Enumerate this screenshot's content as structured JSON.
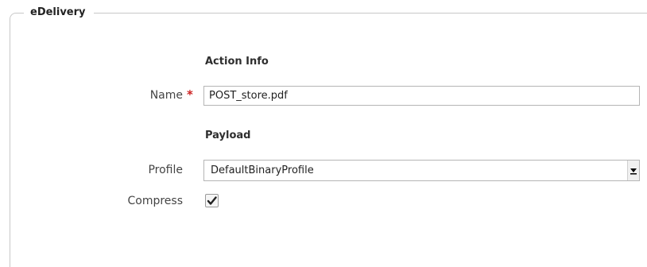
{
  "fieldset": {
    "legend": "eDelivery"
  },
  "action_info": {
    "title": "Action Info",
    "name_label": "Name",
    "required_mark": "*",
    "name_value": "POST_store.pdf"
  },
  "payload": {
    "title": "Payload",
    "profile_label": "Profile",
    "profile_value": "DefaultBinaryProfile",
    "compress_label": "Compress",
    "compress_checked": true
  },
  "icons": {
    "dropdown": "chevron-down-icon",
    "check": "checkmark-icon"
  }
}
